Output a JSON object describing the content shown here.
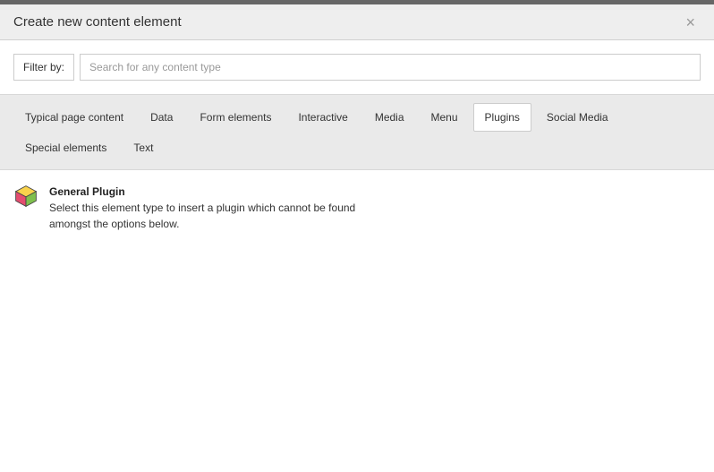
{
  "modal": {
    "title": "Create new content element",
    "close_label": "×"
  },
  "filter": {
    "label": "Filter by:",
    "placeholder": "Search for any content type"
  },
  "tabs": [
    {
      "label": "Typical page content",
      "active": false
    },
    {
      "label": "Data",
      "active": false
    },
    {
      "label": "Form elements",
      "active": false
    },
    {
      "label": "Interactive",
      "active": false
    },
    {
      "label": "Media",
      "active": false
    },
    {
      "label": "Menu",
      "active": false
    },
    {
      "label": "Plugins",
      "active": true
    },
    {
      "label": "Social Media",
      "active": false
    },
    {
      "label": "Special elements",
      "active": false
    },
    {
      "label": "Text",
      "active": false
    }
  ],
  "plugin_list": {
    "items": [
      {
        "title": "General Plugin",
        "description": "Select this element type to insert a plugin which cannot be found amongst the options below.",
        "icon": "plugin-cube-icon"
      }
    ]
  }
}
